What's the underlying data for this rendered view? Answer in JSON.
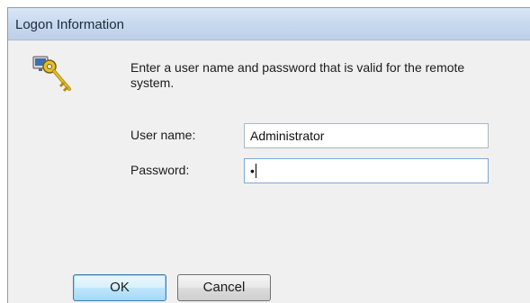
{
  "dialog": {
    "title": "Logon Information",
    "prompt": "Enter a user name and password that is valid for the remote system.",
    "icon": "key-icon"
  },
  "form": {
    "username_label": "User name:",
    "username_value": "Administrator",
    "password_label": "Password:",
    "password_value": "•"
  },
  "buttons": {
    "ok_label": "OK",
    "cancel_label": "Cancel"
  },
  "colors": {
    "titlebar": "#c8d9ee",
    "dialog_bg": "#f0f0f0",
    "default_button_border": "#3c7fb1"
  }
}
